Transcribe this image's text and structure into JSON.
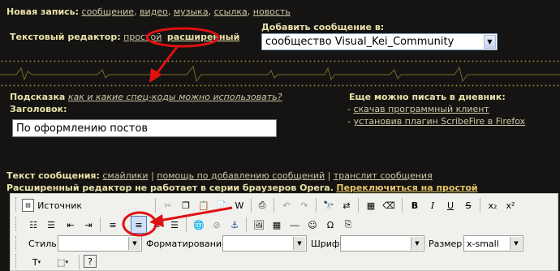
{
  "new_post": {
    "label": "Новая запись:",
    "links": [
      "сообщение",
      "видео",
      "музыка",
      "ссылка",
      "новость"
    ]
  },
  "editor_mode": {
    "label": "Текстовый редактор:",
    "simple": "простой",
    "advanced": "расширенный"
  },
  "add_to": {
    "label": "Добавить сообщение в:",
    "selected": "сообщество Visual_Kei_Community"
  },
  "hint": {
    "label": "Подсказка",
    "link": "как и какие спец-коды можно использовать?"
  },
  "title_field": {
    "label": "Заголовок:",
    "value": "По оформлению постов"
  },
  "more_ways": {
    "label": "Еще можно писать в дневник:",
    "items": [
      "скачав программный клиент",
      "установив плагин ScribeFire в Firefox"
    ]
  },
  "message": {
    "label": "Текст сообщения:",
    "links": [
      "смайлики",
      "помощь по добавлению сообщений",
      "транслит сообщения"
    ],
    "warning": "Расширенный редактор не работает в серии браузеров Opera.",
    "switch_link": "Переключиться на простой"
  },
  "toolbar": {
    "source_label": "Источник",
    "style_label": "Стиль",
    "format_label": "Форматирование",
    "font_label": "Шрифт",
    "size_label": "Размер",
    "size_value": "x-small",
    "help_label": "?",
    "subscript": "x₂",
    "superscript": "x²",
    "bold": "B",
    "italic": "I",
    "underline": "U",
    "strike": "S"
  },
  "colors": {
    "background": "#151412",
    "label": "#e9e2a8",
    "link": "#cfc6a6",
    "annotation": "#e01010"
  }
}
